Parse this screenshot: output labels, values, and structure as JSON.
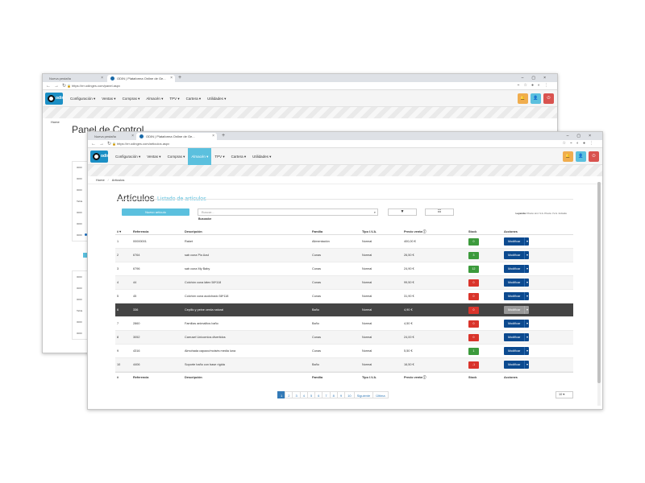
{
  "back_window": {
    "tabs": [
      {
        "label": "Nueva pestaña"
      },
      {
        "label": "ODIN | Plataforma Online de Ge..."
      }
    ],
    "url": "https://rrr.odinges.com/panel.aspx",
    "menu": [
      "Configuración ▾",
      "Ventas ▾",
      "Compras ▾",
      "Almacén ▾",
      "TPV ▾",
      "Cartera ▾",
      "Utilidades ▾"
    ],
    "breadcrumb": "Home",
    "title": "Panel de Control",
    "panel_labels": [
      "0000",
      "0000",
      "0000",
      "Tabla",
      "0000",
      "0000",
      "0000"
    ],
    "panel_labels_2": [
      "0000",
      "0000",
      "0000",
      "Tabla",
      "0000",
      "0000"
    ]
  },
  "front_window": {
    "tabs": [
      {
        "label": "Nueva pestaña"
      },
      {
        "label": "ODIN | Plataforma Online de Ge..."
      }
    ],
    "url": "https://rrr.odinges.com/articulos.aspx",
    "logo_text": "odin",
    "menu": [
      {
        "label": "Configuración ▾",
        "active": false
      },
      {
        "label": "Ventas ▾",
        "active": false
      },
      {
        "label": "Compras ▾",
        "active": false
      },
      {
        "label": "Almacén ▾",
        "active": true
      },
      {
        "label": "TPV ▾",
        "active": false
      },
      {
        "label": "Cartera ▾",
        "active": false
      },
      {
        "label": "Utilidades ▾",
        "active": false
      }
    ],
    "breadcrumb": {
      "home": "Home",
      "current": "Artículos"
    },
    "page_title": "Artículos",
    "page_subtitle": "Listado de artículos",
    "new_button": "Nuevo artículo",
    "search_placeholder": "Buscar...",
    "search_label": "Buscador",
    "legend": {
      "label": "Leyenda:",
      "items": "Precio sin I.V.A.   Precio I.V.A. Incluido"
    },
    "columns": [
      "# ▾",
      "Referencia",
      "Descripción",
      "Familia",
      "Tipo I.V.A.",
      "Precio venta ⓘ",
      "Stock",
      "Acciones"
    ],
    "footer_columns": [
      "#",
      "Referencia",
      "Descripción",
      "Familia",
      "Tipo I.V.A.",
      "Precio venta ⓘ",
      "Stock",
      "Acciones"
    ],
    "rows": [
      {
        "n": "1",
        "ref": "00000001",
        "desc": "Raket",
        "fam": "Alimentación",
        "iva": "Normal",
        "price": "400,00 €",
        "stock": "0",
        "stock_color": "g"
      },
      {
        "n": "2",
        "ref": "6764",
        "desc": "sab cuna Pio Azul",
        "fam": "Cunas",
        "iva": "Normal",
        "price": "26,50 €",
        "stock": "3",
        "stock_color": "g"
      },
      {
        "n": "3",
        "ref": "6796",
        "desc": "sab cuna My Baby",
        "fam": "Cunas",
        "iva": "Normal",
        "price": "24,90 €",
        "stock": "12",
        "stock_color": "g"
      },
      {
        "n": "4",
        "ref": "44",
        "desc": "Colchón cuna látex 58*118",
        "fam": "Cunas",
        "iva": "Normal",
        "price": "99,50 €",
        "stock": "0",
        "stock_color": "r"
      },
      {
        "n": "5",
        "ref": "45",
        "desc": "Colchón cuna acolchado 58*118",
        "fam": "Cunas",
        "iva": "Normal",
        "price": "31,90 €",
        "stock": "0",
        "stock_color": "r"
      },
      {
        "n": "6",
        "ref": "336",
        "desc": "Cepillo y peine cerda natural",
        "fam": "Baño",
        "iva": "Normal",
        "price": "4,90 €",
        "stock": "0",
        "stock_color": "r"
      },
      {
        "n": "7",
        "ref": "2860",
        "desc": "Familias animalitos baño",
        "fam": "Baño",
        "iva": "Normal",
        "price": "4,50 €",
        "stock": "0",
        "stock_color": "r"
      },
      {
        "n": "8",
        "ref": "3052",
        "desc": "Carrusel Unicornios divertidos",
        "fam": "Cunas",
        "iva": "Normal",
        "price": "24,00 €",
        "stock": "0",
        "stock_color": "r"
      },
      {
        "n": "9",
        "ref": "4316",
        "desc": "Almohada capazo/moisés media luna",
        "fam": "Cunas",
        "iva": "Normal",
        "price": "5,50 €",
        "stock": "1",
        "stock_color": "g"
      },
      {
        "n": "10",
        "ref": "4406",
        "desc": "Soporte baño con base rígida",
        "fam": "Baño",
        "iva": "Normal",
        "price": "16,50 €",
        "stock": "-1",
        "stock_color": "r"
      }
    ],
    "action_label": "Modificar",
    "pagination": [
      "1",
      "2",
      "3",
      "4",
      "5",
      "6",
      "7",
      "8",
      "9",
      "10",
      "Siguiente",
      "Última"
    ],
    "current_page": "1",
    "page_size": "10 ▾"
  },
  "colors": {
    "accent": "#5bc0de",
    "primary": "#0c4a8f",
    "stock_green": "#3c9a3c",
    "stock_red": "#d9342b",
    "warn": "#f0ad4e",
    "danger": "#d9534f"
  }
}
